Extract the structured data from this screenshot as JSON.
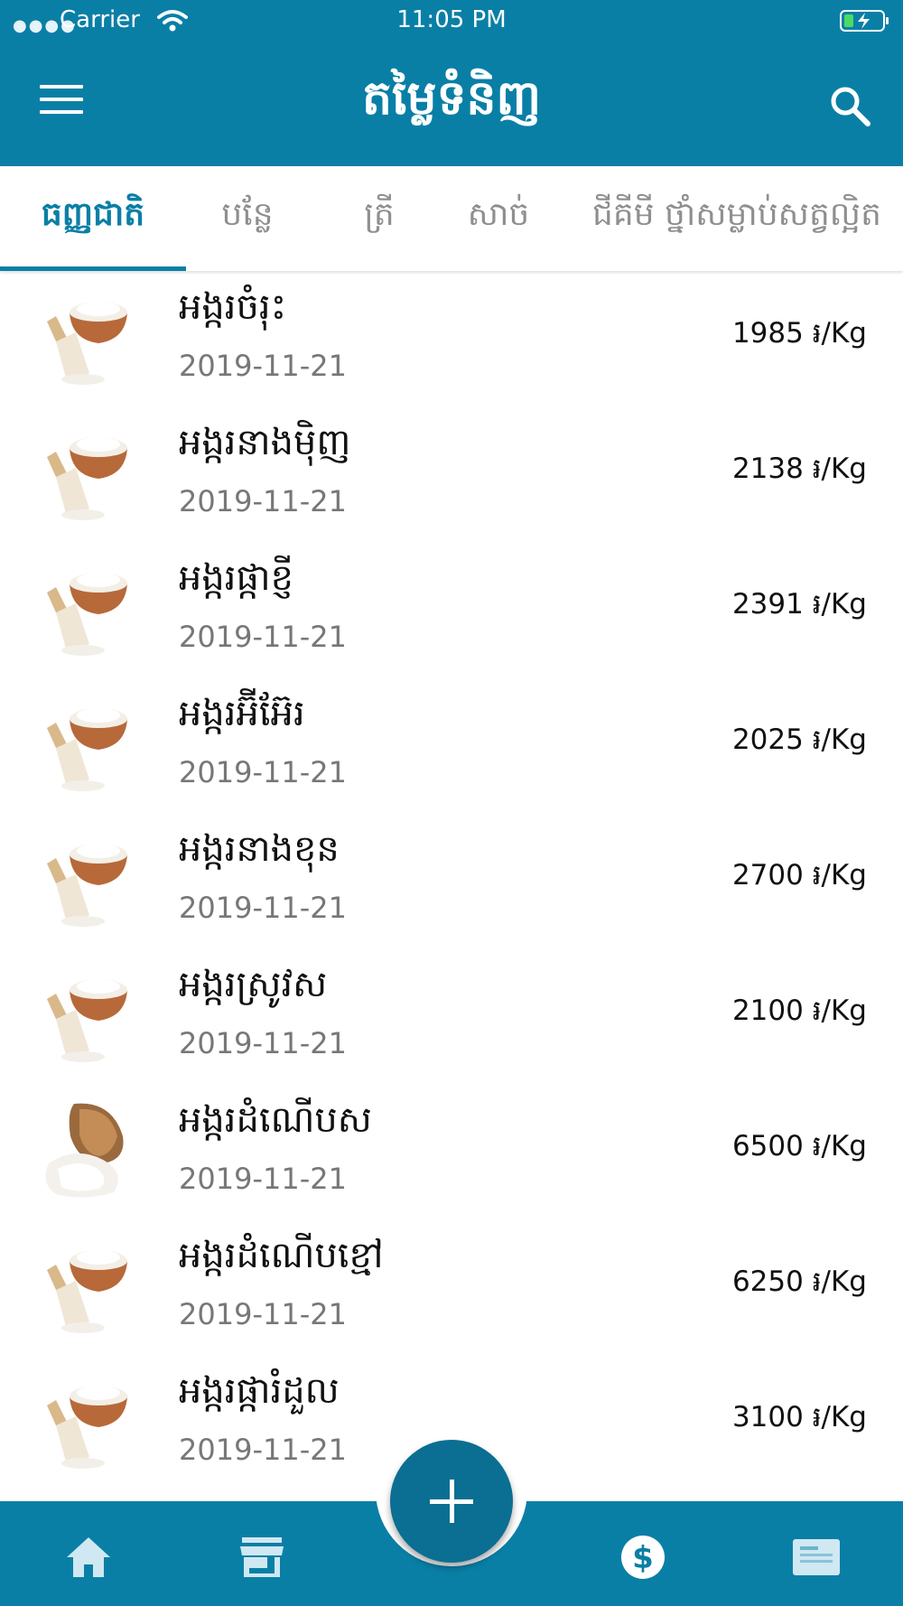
{
  "status_bar": {
    "carrier": "Carrier",
    "time": "11:05 PM"
  },
  "app_bar": {
    "title": "តម្លៃទំនិញ"
  },
  "tabs": [
    {
      "label": "ធញ្ញជាតិ",
      "active": true
    },
    {
      "label": "បន្លែ",
      "active": false
    },
    {
      "label": "ត្រី",
      "active": false
    },
    {
      "label": "សាច់",
      "active": false
    },
    {
      "label": "ជីគីមី ថ្នាំសម្លាប់សត្វល្អិត",
      "active": false
    }
  ],
  "items": [
    {
      "name": "អង្ករចំរុះ",
      "date": "2019-11-21",
      "price": "1985 ៛/Kg",
      "image": "rice-bowl-scoop"
    },
    {
      "name": "អង្ករនាងម៉ិញ",
      "date": "2019-11-21",
      "price": "2138 ៛/Kg",
      "image": "rice-bowl-scoop"
    },
    {
      "name": "អង្ករផ្កាខ្ញី",
      "date": "2019-11-21",
      "price": "2391 ៛/Kg",
      "image": "rice-bowl-scoop"
    },
    {
      "name": "អង្ករអ៊ីអ៊ែរ",
      "date": "2019-11-21",
      "price": "2025 ៛/Kg",
      "image": "rice-bowl-scoop"
    },
    {
      "name": "អង្ករនាងខុន",
      "date": "2019-11-21",
      "price": "2700 ៛/Kg",
      "image": "rice-bowl-scoop"
    },
    {
      "name": "អង្ករស្រូវស",
      "date": "2019-11-21",
      "price": "2100 ៛/Kg",
      "image": "rice-bowl-scoop"
    },
    {
      "name": "អង្ករដំណើបស",
      "date": "2019-11-21",
      "price": "6500 ៛/Kg",
      "image": "rice-bowl-spilled"
    },
    {
      "name": "អង្ករដំណើបខ្មៅ",
      "date": "2019-11-21",
      "price": "6250 ៛/Kg",
      "image": "rice-bowl-scoop"
    },
    {
      "name": "អង្ករផ្ការំដួល",
      "date": "2019-11-21",
      "price": "3100 ៛/Kg",
      "image": "rice-bowl-scoop"
    }
  ],
  "bottom_nav": [
    {
      "icon": "home-icon"
    },
    {
      "icon": "store-icon"
    },
    {
      "icon": "add-icon"
    },
    {
      "icon": "dollar-icon"
    },
    {
      "icon": "news-icon"
    }
  ],
  "colors": {
    "primary": "#0a7fa6",
    "tab_inactive": "#8f8f8f",
    "date_text": "#777777"
  }
}
